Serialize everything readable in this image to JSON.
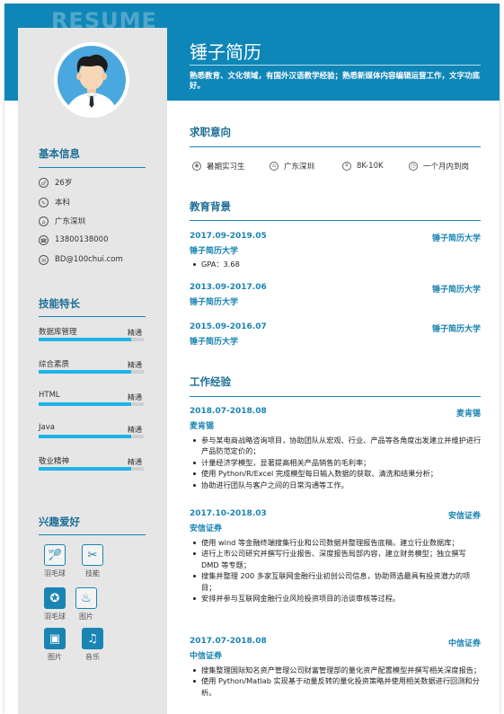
{
  "watermark": "RESUME",
  "name": "锤子简历",
  "intro": "熟悉教育、文化领域，有国外汉语教学经验；熟悉新媒体内容编辑运营工作，文字功底好。",
  "colors": {
    "accent": "#0f86b8",
    "heading": "#1d6f97",
    "skill_bar": "#20b3ea",
    "sidebar_bg": "#e6e6e6"
  },
  "sidebar": {
    "basic_title": "基本信息",
    "basic": [
      {
        "icon": "age-icon",
        "text": "26岁"
      },
      {
        "icon": "education-icon",
        "text": "本科"
      },
      {
        "icon": "location-icon",
        "text": "广东深圳"
      },
      {
        "icon": "phone-icon",
        "text": "13800138000"
      },
      {
        "icon": "email-icon",
        "text": "BD@100chui.com"
      }
    ],
    "skills_title": "技能特长",
    "skills": [
      {
        "name": "数据库管理",
        "level": "精通",
        "progress": 0.88
      },
      {
        "name": "综合素质",
        "level": "精通",
        "progress": 0.88
      },
      {
        "name": "HTML",
        "level": "精通",
        "progress": 0.88
      },
      {
        "name": "Java",
        "level": "精通",
        "progress": 0.88
      },
      {
        "name": "敬业精神",
        "level": "精通",
        "progress": 0.88
      }
    ],
    "hobbies_title": "兴趣爱好",
    "hobbies": [
      {
        "icon": "badminton-icon",
        "label": "羽毛球"
      },
      {
        "icon": "tools-icon",
        "label": "技能"
      },
      {
        "icon": "medal-icon",
        "label": "羽毛球"
      },
      {
        "icon": "cooking-icon",
        "label": "图片"
      },
      {
        "icon": "picture-icon",
        "label": "图片"
      },
      {
        "icon": "music-icon",
        "label": "音乐"
      }
    ]
  },
  "intent": {
    "title": "求职意向",
    "items": [
      {
        "icon": "job-type-icon",
        "text": "暑期实习生"
      },
      {
        "icon": "location-icon",
        "text": "广东深圳"
      },
      {
        "icon": "salary-icon",
        "text": "8K-10K"
      },
      {
        "icon": "clock-icon",
        "text": "一个月内到岗"
      }
    ]
  },
  "education": {
    "title": "教育背景",
    "entries": [
      {
        "date": "2017.09-2019.05",
        "right": "锤子简历大学",
        "org": "锤子简历大学",
        "bullets": [
          "GPA：3.68"
        ]
      },
      {
        "date": "2013.09-2017.06",
        "right": "锤子简历大学",
        "org": "锤子简历大学",
        "bullets": []
      },
      {
        "date": "2015.09-2016.07",
        "right": "锤子简历大学",
        "org": "锤子简历大学",
        "bullets": []
      }
    ]
  },
  "work": {
    "title": "工作经验",
    "entries": [
      {
        "date": "2018.07-2018.08",
        "right": "麦肯锡",
        "org": "麦肯锡",
        "bullets": [
          "参与某电商战略咨询项目，协助团队从宏观、行业、产品等各角度出发建立并维护进行产品防范定价的；",
          "计量经济学模型，显著提高相关产品销售的毛利率；",
          "使用 Python/R/Excel 完成模型每日输入数据的获取、清洗和结果分析；",
          "协助进行团队与客户之间的日常沟通等工作。"
        ]
      },
      {
        "date": "2017.10-2018.03",
        "right": "安信证券",
        "org": "安信证券",
        "bullets": [
          "使用 wind 等金融终端搜集行业和公司数据并整理报告底稿，建立行业数据库；",
          "进行上市公司研究并撰写行业报告、深度报告局部内容，建立财务模型；独立撰写 DMD 等专题；",
          "搜集并整理 200 多家互联网金融行业初创公司信息，协助筛选最具有投资潜力的项目；",
          "安排并参与互联网金融行业风险投资项目的洽谈审核等过程。"
        ]
      },
      {
        "date": "2017.07-2018.08",
        "right": "中信证券",
        "org": "中信证券",
        "bullets": [
          "搜集整理国际知名资产管理公司财富管理部的量化资产配置模型并撰写相关深度报告；",
          "使用 Python/Matlab 实现基于动量反转的量化投资策略并使用相关数据进行回测和分析。"
        ]
      }
    ]
  }
}
